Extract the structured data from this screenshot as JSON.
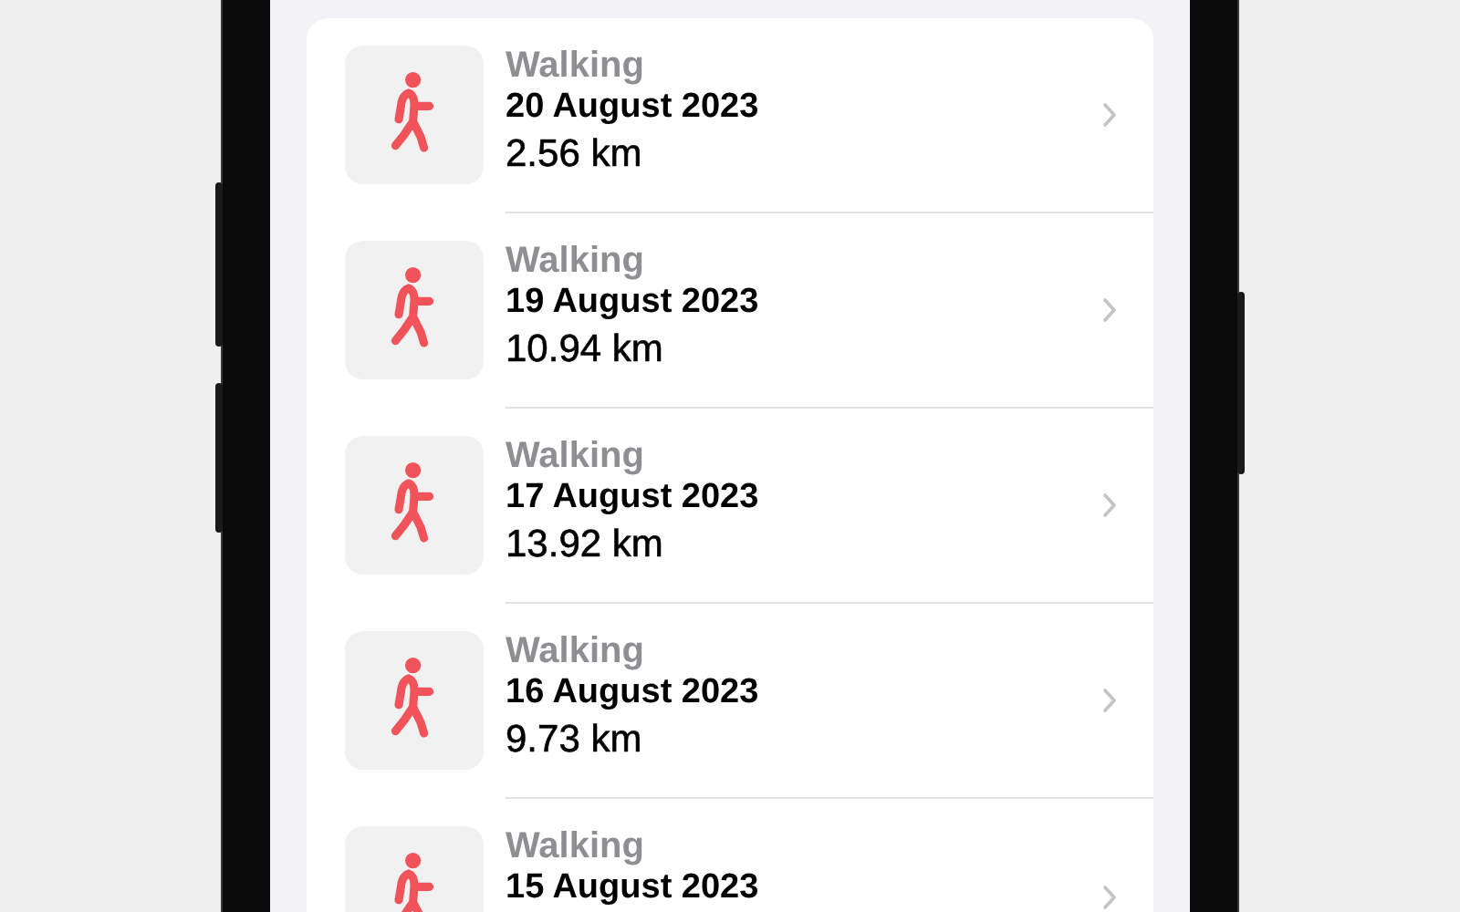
{
  "workouts": [
    {
      "type": "Walking",
      "date": "20 August 2023",
      "distance": "2.56 km"
    },
    {
      "type": "Walking",
      "date": "19 August 2023",
      "distance": "10.94 km"
    },
    {
      "type": "Walking",
      "date": "17 August 2023",
      "distance": "13.92 km"
    },
    {
      "type": "Walking",
      "date": "16 August 2023",
      "distance": "9.73 km"
    },
    {
      "type": "Walking",
      "date": "15 August 2023"
    }
  ]
}
